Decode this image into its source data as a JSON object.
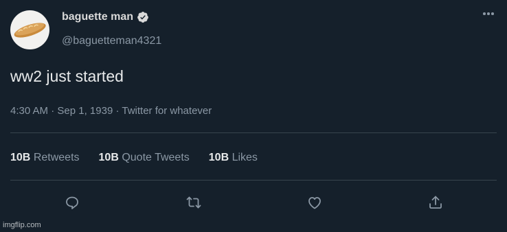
{
  "author": {
    "display_name": "baguette man",
    "handle": "@baguetteman4321",
    "verified": true,
    "avatar_icon": "baguette-icon"
  },
  "tweet": {
    "text": "ww2 just started",
    "time": "4:30 AM",
    "date": "Sep 1, 1939",
    "source": "Twitter for whatever",
    "separator": "·"
  },
  "stats": {
    "retweets_count": "10B",
    "retweets_label": "Retweets",
    "quotes_count": "10B",
    "quotes_label": "Quote Tweets",
    "likes_count": "10B",
    "likes_label": "Likes"
  },
  "actions": [
    "reply-icon",
    "retweet-icon",
    "like-icon",
    "share-icon"
  ],
  "watermark": "imgflip.com",
  "colors": {
    "background": "#15202b",
    "divider": "#38444d",
    "secondary_text": "#8b98a5",
    "primary_text": "#e7e9ea"
  }
}
